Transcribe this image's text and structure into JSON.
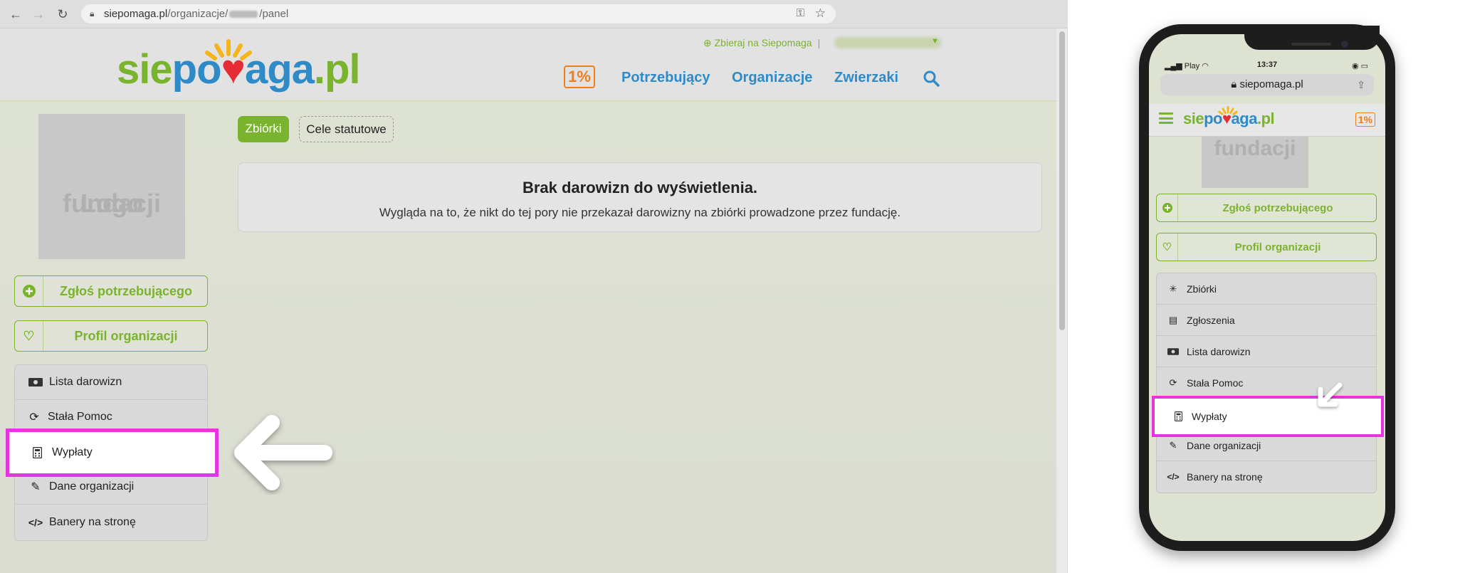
{
  "browser": {
    "url_domain": "siepomaga.pl",
    "url_path_prefix": "/organizacje/",
    "url_path_suffix": "/panel"
  },
  "site": {
    "logo": {
      "part1": "sie",
      "part2": "po",
      "heart": "♥",
      "part3": "aga",
      "part4": ".pl"
    },
    "collect_link": "Zbieraj na Siepomaga",
    "separator": "|",
    "one_percent": "1%",
    "nav": [
      "Potrzebujący",
      "Organizacje",
      "Zwierzaki"
    ]
  },
  "sidebar": {
    "logo_placeholder_line1": "Logo",
    "logo_placeholder_line2": "fundacji",
    "report_button": "Zgłoś potrzebującego",
    "profile_button": "Profil organizacji",
    "menu": [
      {
        "label": "Lista darowizn",
        "icon": "money-icon"
      },
      {
        "label": "Stała Pomoc",
        "icon": "recurring-help-icon"
      },
      {
        "label": "Wypłaty",
        "icon": "calculator-icon"
      },
      {
        "label": "Dane organizacji",
        "icon": "edit-icon"
      },
      {
        "label": "Banery na stronę",
        "icon": "code-icon"
      }
    ]
  },
  "content": {
    "tabs": [
      "Zbiórki",
      "Cele statutowe"
    ],
    "empty_title": "Brak darowizn do wyświetlenia.",
    "empty_text": "Wygląda na to, że nikt do tej pory nie przekazał darowizny na zbiórki prowadzone przez fundację."
  },
  "mobile": {
    "carrier": "Play",
    "time": "13:37",
    "url": "siepomaga.pl",
    "logo_placeholder": "fundacji",
    "report_button": "Zgłoś potrzebującego",
    "profile_button": "Profil organizacji",
    "menu": [
      {
        "label": "Zbiórki",
        "icon": "fundraiser-icon"
      },
      {
        "label": "Zgłoszenia",
        "icon": "id-card-icon"
      },
      {
        "label": "Lista darowizn",
        "icon": "money-icon"
      },
      {
        "label": "Stała Pomoc",
        "icon": "recurring-help-icon"
      },
      {
        "label": "Wypłaty",
        "icon": "calculator-icon"
      },
      {
        "label": "Dane organizacji",
        "icon": "edit-icon"
      },
      {
        "label": "Banery na stronę",
        "icon": "code-icon"
      }
    ]
  },
  "colors": {
    "brand_green": "#7ab32e",
    "brand_blue": "#2e8bc7",
    "brand_red": "#e52b33",
    "highlight_magenta": "#e535e0",
    "orange": "#ef7d1a"
  }
}
